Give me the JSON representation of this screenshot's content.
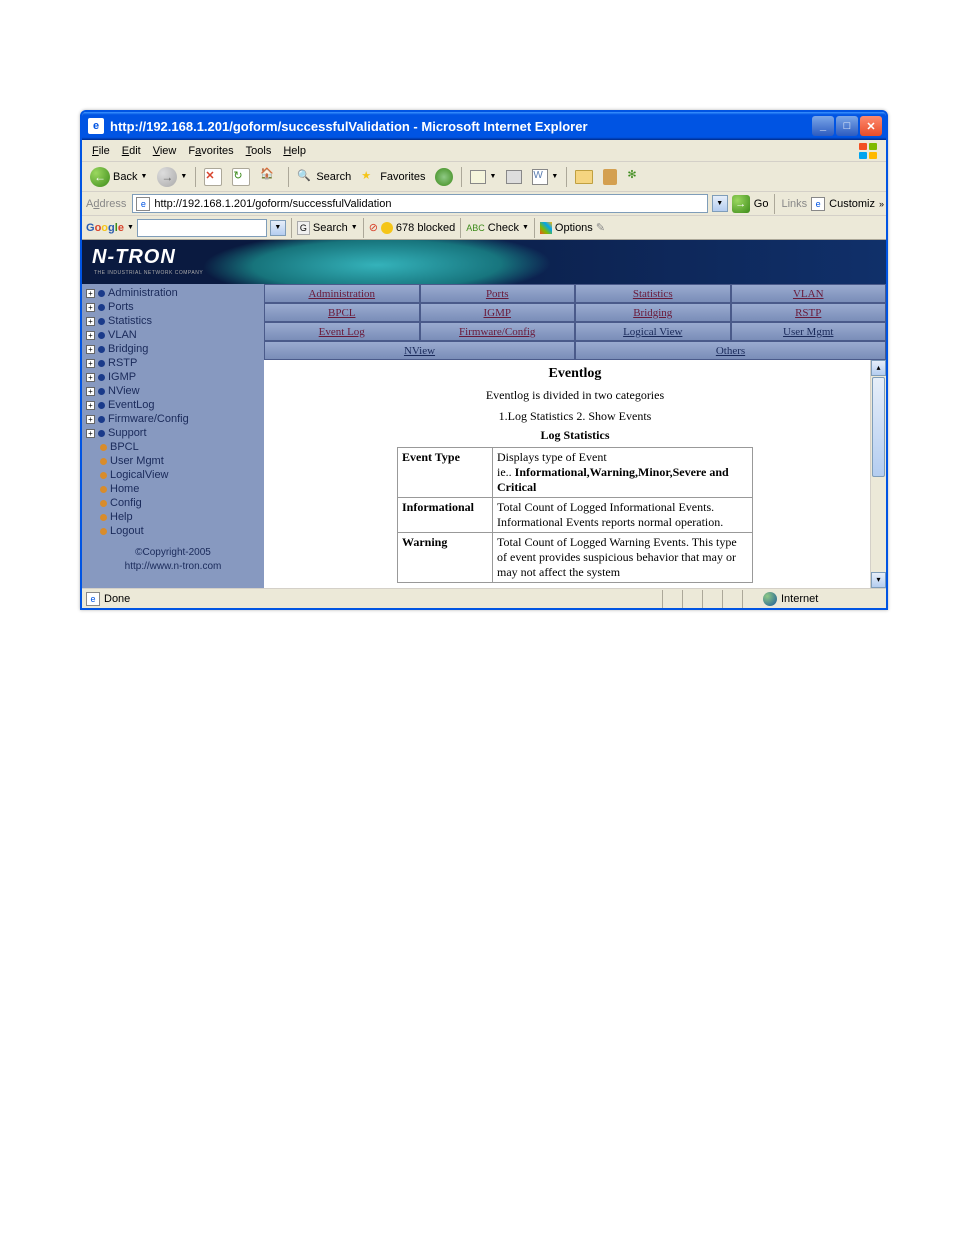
{
  "window": {
    "title": "http://192.168.1.201/goform/successfulValidation - Microsoft Internet Explorer"
  },
  "menubar": [
    "File",
    "Edit",
    "View",
    "Favorites",
    "Tools",
    "Help"
  ],
  "toolbar": {
    "back": "Back",
    "search": "Search",
    "favorites": "Favorites"
  },
  "addressbar": {
    "label": "Address",
    "url": "http://192.168.1.201/goform/successfulValidation",
    "go": "Go",
    "links": "Links",
    "customize": "Customiz"
  },
  "googlebar": {
    "search": "Search",
    "blocked": "678 blocked",
    "check": "Check",
    "options": "Options"
  },
  "banner": {
    "logo": "N-TRON",
    "tagline": "THE INDUSTRIAL NETWORK COMPANY"
  },
  "sidebar": {
    "items": [
      {
        "exp": true,
        "dot": "blue",
        "label": "Administration"
      },
      {
        "exp": true,
        "dot": "blue",
        "label": "Ports"
      },
      {
        "exp": true,
        "dot": "blue",
        "label": "Statistics"
      },
      {
        "exp": true,
        "dot": "blue",
        "label": "VLAN"
      },
      {
        "exp": true,
        "dot": "blue",
        "label": "Bridging"
      },
      {
        "exp": true,
        "dot": "blue",
        "label": "RSTP"
      },
      {
        "exp": true,
        "dot": "blue",
        "label": "IGMP"
      },
      {
        "exp": true,
        "dot": "blue",
        "label": "NView"
      },
      {
        "exp": true,
        "dot": "blue",
        "label": "EventLog"
      },
      {
        "exp": true,
        "dot": "blue",
        "label": "Firmware/Config"
      },
      {
        "exp": true,
        "dot": "blue",
        "label": "Support"
      },
      {
        "exp": false,
        "dot": "orange",
        "label": "BPCL"
      },
      {
        "exp": false,
        "dot": "orange",
        "label": "User Mgmt"
      },
      {
        "exp": false,
        "dot": "orange",
        "label": "LogicalView"
      },
      {
        "exp": false,
        "dot": "orange",
        "label": "Home"
      },
      {
        "exp": false,
        "dot": "orange",
        "label": "Config"
      },
      {
        "exp": false,
        "dot": "orange",
        "label": "Help"
      },
      {
        "exp": false,
        "dot": "orange",
        "label": "Logout"
      }
    ],
    "copyright": "©Copyright-2005",
    "url": "http://www.n-tron.com"
  },
  "tabs": {
    "row1": [
      "Administration",
      "Ports",
      "Statistics",
      "VLAN"
    ],
    "row2": [
      "BPCL",
      "IGMP",
      "Bridging",
      "RSTP"
    ],
    "row3": [
      "Event Log",
      "Firmware/Config",
      "Logical View",
      "User Mgmt"
    ],
    "row4": [
      "NView",
      "Others"
    ]
  },
  "content": {
    "title": "Eventlog",
    "desc": "Eventlog is divided in two categories",
    "cats": "1.Log Statistics   2. Show Events",
    "section": "Log Statistics",
    "table": [
      {
        "type": "Event Type",
        "desc_pre": "Displays type of Event",
        "desc_bold": "Informational,Warning,Minor,Severe and Critical",
        "desc_prefix": "ie.. "
      },
      {
        "type": "Informational",
        "desc": "Total Count of Logged Informational Events. Informational Events reports normal operation."
      },
      {
        "type": "Warning",
        "desc": "Total Count of Logged Warning Events. This type of event provides suspicious behavior that may or may not affect the system"
      }
    ]
  },
  "statusbar": {
    "done": "Done",
    "zone": "Internet"
  }
}
